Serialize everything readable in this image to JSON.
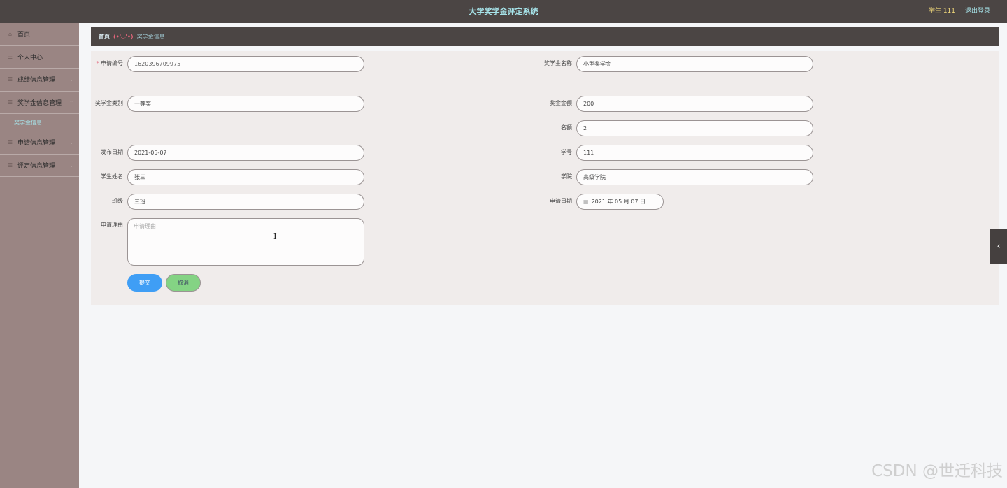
{
  "header": {
    "title": "大学奖学金评定系统",
    "user": "学生 111",
    "logout": "退出登录"
  },
  "sidebar": {
    "items": [
      {
        "label": "首页",
        "icon": "home-icon"
      },
      {
        "label": "个人中心",
        "icon": "user-icon"
      },
      {
        "label": "成绩信息管理",
        "icon": "list-icon"
      },
      {
        "label": "奖学金信息管理",
        "icon": "list-icon"
      },
      {
        "label": "申请信息管理",
        "icon": "list-icon"
      },
      {
        "label": "评定信息管理",
        "icon": "list-icon"
      }
    ],
    "subitem": "奖学金信息"
  },
  "breadcrumb": {
    "home": "首页",
    "sep": "(•'◡'•)",
    "current": "奖学金信息"
  },
  "form": {
    "app_no_label": "申请编号",
    "app_no_value": "1620396709975",
    "sch_name_label": "奖学金名称",
    "sch_name_value": "小型奖学金",
    "sch_type_label": "奖学金类别",
    "sch_type_value": "一等奖",
    "amount_label": "奖金金额",
    "amount_value": "200",
    "quota_label": "名额",
    "quota_value": "2",
    "pub_date_label": "发布日期",
    "pub_date_value": "2021-05-07",
    "stu_no_label": "学号",
    "stu_no_value": "111",
    "stu_name_label": "学生姓名",
    "stu_name_value": "张三",
    "college_label": "学院",
    "college_value": "高级学院",
    "class_label": "班级",
    "class_value": "三班",
    "apply_date_label": "申请日期",
    "apply_date_value": "2021 年 05 月 07 日",
    "reason_label": "申请理由",
    "reason_placeholder": "申请理由",
    "submit": "提交",
    "cancel": "取消"
  },
  "watermark": "CSDN @世迁科技",
  "colors": {
    "header_bg": "#4b4544",
    "sidebar_bg": "#9a8583",
    "accent_text": "#a6e3e9",
    "submit_bg": "#3f9ef5",
    "cancel_bg": "#84d384"
  }
}
